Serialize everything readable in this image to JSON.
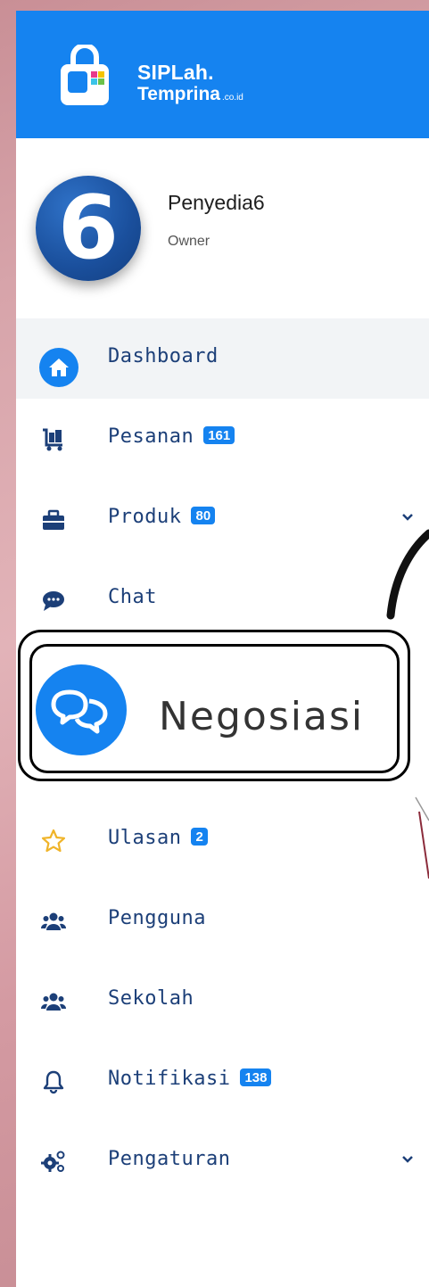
{
  "brand": {
    "line1": "SIPLah.",
    "line2": "Temprina",
    "suffix": ".co.id",
    "header_color": "#1583f0"
  },
  "profile": {
    "avatar_text": "6",
    "name": "Penyedia6",
    "role": "Owner"
  },
  "menu": {
    "dashboard": {
      "label": "Dashboard",
      "icon": "home-icon"
    },
    "pesanan": {
      "label": "Pesanan",
      "badge": "161",
      "icon": "cart-icon"
    },
    "produk": {
      "label": "Produk",
      "badge": "80",
      "icon": "briefcase-icon"
    },
    "chat": {
      "label": "Chat",
      "icon": "chat-icon"
    },
    "negosiasi": {
      "label": "Negosiasi",
      "icon": "negotiation-icon"
    },
    "ulasan": {
      "label": "Ulasan",
      "badge": "2",
      "icon": "star-icon"
    },
    "pengguna": {
      "label": "Pengguna",
      "icon": "users-icon"
    },
    "sekolah": {
      "label": "Sekolah",
      "icon": "users-icon"
    },
    "notifikasi": {
      "label": "Notifikasi",
      "badge": "138",
      "icon": "bell-icon"
    },
    "pengaturan": {
      "label": "Pengaturan",
      "icon": "gears-icon"
    }
  },
  "colors": {
    "accent": "#1583f0",
    "menu_text": "#1c3f78",
    "star": "#f0b429"
  }
}
